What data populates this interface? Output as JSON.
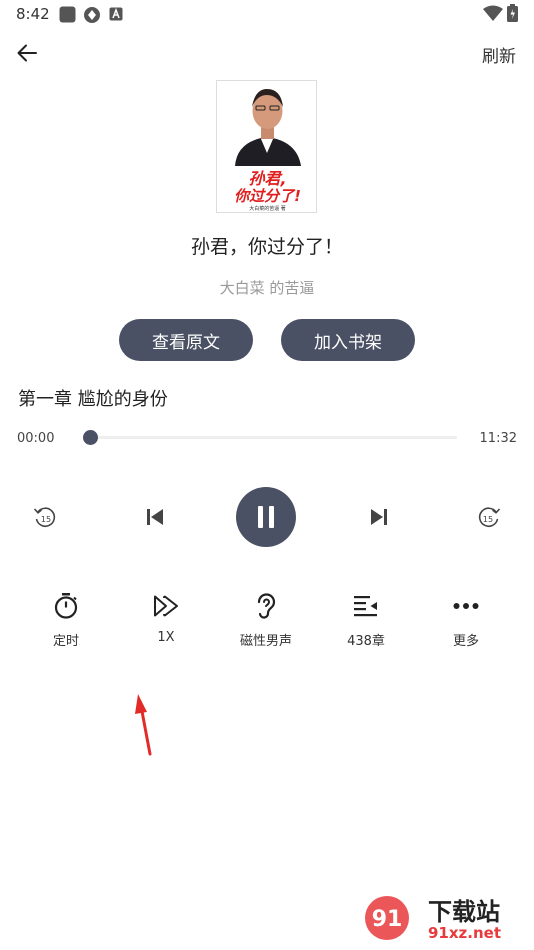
{
  "status_bar": {
    "time": "8:42"
  },
  "header": {
    "refresh_label": "刷新"
  },
  "book": {
    "cover_title": "孙君，你过分了!",
    "cover_subtitle": "大白菜的苦逼 著",
    "title": "孙君，你过分了！",
    "author": "大白菜 的苦逼"
  },
  "actions": {
    "view_original_label": "查看原文",
    "add_to_shelf_label": "加入书架"
  },
  "player": {
    "chapter_title": "第一章 尴尬的身份",
    "current_time": "00:00",
    "total_time": "11:32",
    "progress_fraction": 0.0,
    "rewind_seconds": "15",
    "forward_seconds": "15",
    "state": "playing",
    "accent_color": "#4a5164"
  },
  "functions": [
    {
      "label": "定时",
      "icon": "timer-icon"
    },
    {
      "label": "1X",
      "icon": "playback-speed-icon"
    },
    {
      "label": "磁性男声",
      "icon": "ear-voice-icon"
    },
    {
      "label": "438章",
      "icon": "chapter-list-icon"
    },
    {
      "label": "更多",
      "icon": "more-dots-icon"
    }
  ],
  "watermark": {
    "brand": "下载站",
    "site": "91xz.net"
  }
}
